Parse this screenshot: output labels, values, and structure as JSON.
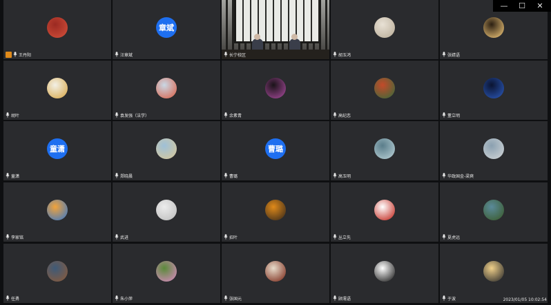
{
  "window": {
    "controls": [
      "—",
      "☐",
      "✕"
    ]
  },
  "participants": [
    {
      "name": "王丹阳",
      "avatar": "image",
      "colors": [
        "#9b2a22",
        "#d24f3a"
      ],
      "hand_raised": true
    },
    {
      "name": "汪章斌",
      "avatar": "text",
      "initials": "章斌"
    },
    {
      "name": "长宁校区",
      "avatar": "video"
    },
    {
      "name": "胡玉鸿",
      "avatar": "image",
      "colors": [
        "#e8e1d5",
        "#b9ad98"
      ]
    },
    {
      "name": "张婧语",
      "avatar": "image",
      "colors": [
        "#2b1f12",
        "#f0c77a"
      ]
    },
    {
      "name": "胡叶",
      "avatar": "image",
      "colors": [
        "#f2f0e6",
        "#d8a84a"
      ]
    },
    {
      "name": "袁发强（法学）",
      "avatar": "image",
      "colors": [
        "#c9d8e6",
        "#d9624a"
      ]
    },
    {
      "name": "余素青",
      "avatar": "image",
      "colors": [
        "#1a1318",
        "#a54a9a"
      ]
    },
    {
      "name": "高纪恋",
      "avatar": "image",
      "colors": [
        "#c44a2a",
        "#3a6a3a"
      ]
    },
    {
      "name": "董立明",
      "avatar": "image",
      "colors": [
        "#0b1430",
        "#2b58b8"
      ]
    },
    {
      "name": "童潇",
      "avatar": "text",
      "initials": "童潇"
    },
    {
      "name": "郑晓晨",
      "avatar": "image",
      "colors": [
        "#9ec0d8",
        "#d8c89a"
      ]
    },
    {
      "name": "曹璐",
      "avatar": "text",
      "initials": "曹璐"
    },
    {
      "name": "高玉明",
      "avatar": "image",
      "colors": [
        "#5a7d8a",
        "#b8d0d6"
      ]
    },
    {
      "name": "华政国金-梁爽",
      "avatar": "image",
      "colors": [
        "#8aa0b0",
        "#d0d4d6"
      ]
    },
    {
      "name": "李家铭",
      "avatar": "image",
      "colors": [
        "#f2a33a",
        "#3a78c8"
      ]
    },
    {
      "name": "武进",
      "avatar": "image",
      "colors": [
        "#ececec",
        "#bdbdbd"
      ]
    },
    {
      "name": "招叶",
      "avatar": "image",
      "colors": [
        "#e08a1a",
        "#3a2a1a"
      ]
    },
    {
      "name": "丛立先",
      "avatar": "image",
      "colors": [
        "#ffffff",
        "#c0241a"
      ]
    },
    {
      "name": "夏虎远",
      "avatar": "image",
      "colors": [
        "#5a8a9a",
        "#3a5a2a"
      ]
    },
    {
      "name": "任勇",
      "avatar": "image",
      "colors": [
        "#3e5a78",
        "#8a5a3a"
      ]
    },
    {
      "name": "朱小萍",
      "avatar": "image",
      "colors": [
        "#5a8a3a",
        "#d88ac0"
      ]
    },
    {
      "name": "张国元",
      "avatar": "image",
      "colors": [
        "#e8dccb",
        "#7a2a1a"
      ]
    },
    {
      "name": "顾濡语",
      "avatar": "image",
      "colors": [
        "#ffffff",
        "#1a1a1a"
      ]
    },
    {
      "name": "于波",
      "avatar": "image",
      "colors": [
        "#f0d08a",
        "#2a2a2a"
      ]
    }
  ],
  "status": {
    "timestamp": "2023/01/05 10:02:54"
  }
}
